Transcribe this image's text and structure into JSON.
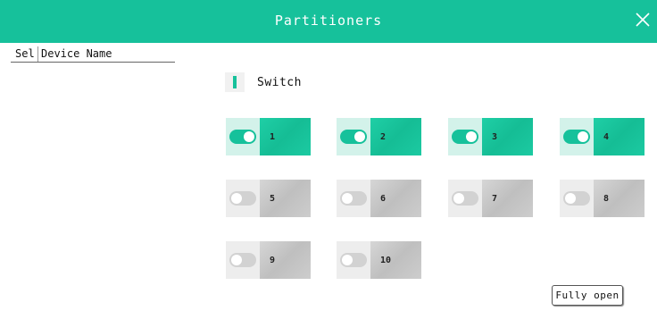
{
  "window": {
    "title": "Partitioners"
  },
  "device_table": {
    "col_sel": "Sel",
    "col_device_name": "Device Name"
  },
  "section": {
    "label": "Switch"
  },
  "zones": [
    {
      "label": "1",
      "on": true
    },
    {
      "label": "2",
      "on": true
    },
    {
      "label": "3",
      "on": true
    },
    {
      "label": "4",
      "on": true
    },
    {
      "label": "5",
      "on": false
    },
    {
      "label": "6",
      "on": false
    },
    {
      "label": "7",
      "on": false
    },
    {
      "label": "8",
      "on": false
    },
    {
      "label": "9",
      "on": false
    },
    {
      "label": "10",
      "on": false
    }
  ],
  "actions": {
    "fully_open": "Fully open"
  },
  "colors": {
    "accent": "#16c19b",
    "on_light": "#d3f2ea",
    "off": "#bfbfbf"
  },
  "icons": {
    "close": "close-icon"
  }
}
